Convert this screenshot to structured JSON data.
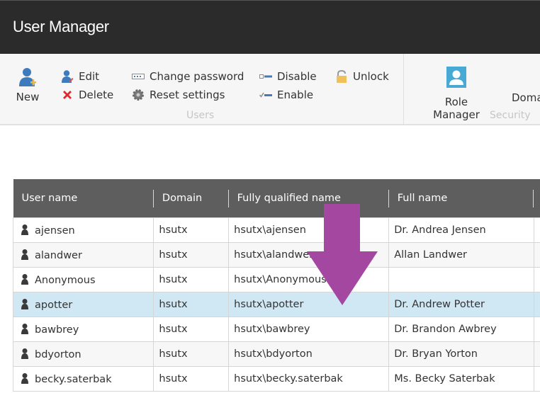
{
  "window": {
    "title": "User Manager"
  },
  "ribbon": {
    "users_group": {
      "label": "Users",
      "new": "New",
      "edit": "Edit",
      "delete": "Delete",
      "change_password": "Change password",
      "reset_settings": "Reset settings",
      "disable": "Disable",
      "enable": "Enable",
      "unlock": "Unlock"
    },
    "security_group": {
      "label": "Security",
      "role_manager": "Role Manager",
      "domain_manager": "Doma"
    }
  },
  "table": {
    "columns": [
      "User name",
      "Domain",
      "Fully qualified name",
      "Full name"
    ],
    "rows": [
      {
        "username": "ajensen",
        "domain": "hsutx",
        "fqn": "hsutx\\ajensen",
        "fullname": "Dr. Andrea Jensen"
      },
      {
        "username": "alandwer",
        "domain": "hsutx",
        "fqn": "hsutx\\alandwer",
        "fullname": "Allan Landwer"
      },
      {
        "username": "Anonymous",
        "domain": "hsutx",
        "fqn": "hsutx\\Anonymous",
        "fullname": ""
      },
      {
        "username": "apotter",
        "domain": "hsutx",
        "fqn": "hsutx\\apotter",
        "fullname": "Dr. Andrew Potter",
        "selected": true
      },
      {
        "username": "bawbrey",
        "domain": "hsutx",
        "fqn": "hsutx\\bawbrey",
        "fullname": "Dr. Brandon Awbrey"
      },
      {
        "username": "bdyorton",
        "domain": "hsutx",
        "fqn": "hsutx\\bdyorton",
        "fullname": "Dr. Bryan Yorton"
      },
      {
        "username": "becky.saterbak",
        "domain": "hsutx",
        "fqn": "hsutx\\becky.saterbak",
        "fullname": "Ms. Becky Saterbak"
      }
    ]
  },
  "annotation": {
    "type": "down-arrow",
    "color": "#a347a0"
  },
  "colors": {
    "titlebar": "#2b2b2b",
    "header": "#5e5e5e",
    "selected_row": "#d0e7f4",
    "accent_blue": "#3e7bbd"
  }
}
